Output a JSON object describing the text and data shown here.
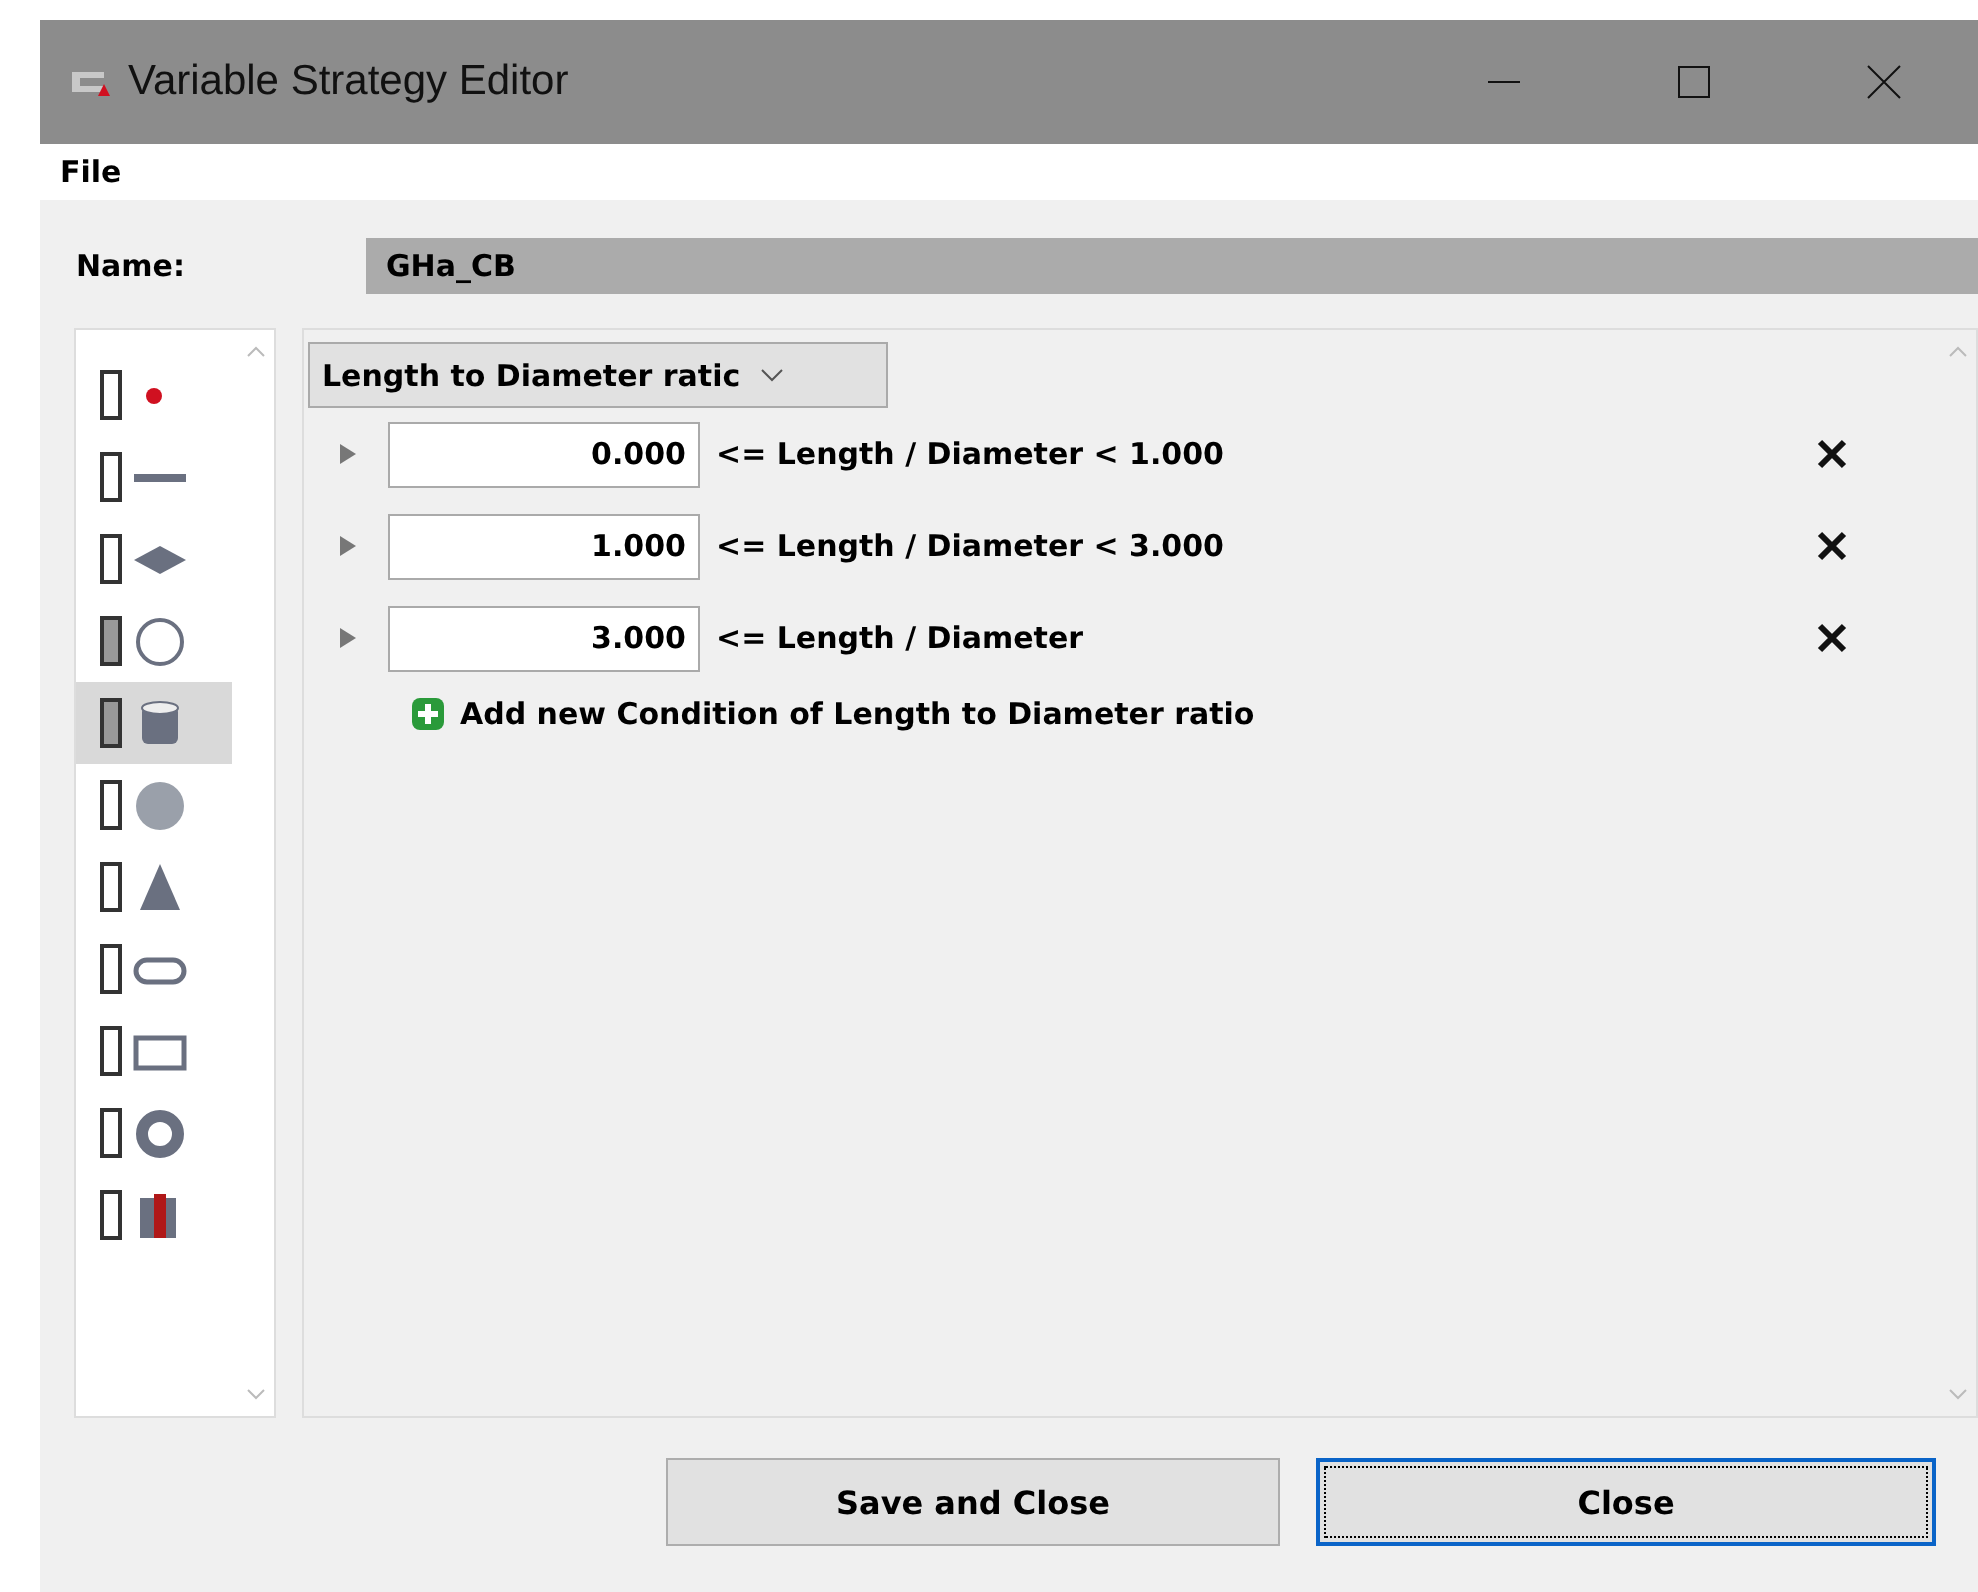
{
  "window": {
    "title": "Variable Strategy Editor"
  },
  "menu": [
    "File"
  ],
  "name_field": {
    "label": "Name:",
    "value": "GHa_CB"
  },
  "shapes": [
    {
      "kind": "point",
      "checked": false,
      "selected": false
    },
    {
      "kind": "line",
      "checked": false,
      "selected": false
    },
    {
      "kind": "plate",
      "checked": false,
      "selected": false
    },
    {
      "kind": "ring",
      "checked": true,
      "selected": false
    },
    {
      "kind": "cylinder",
      "checked": true,
      "selected": true
    },
    {
      "kind": "sphere",
      "checked": false,
      "selected": false
    },
    {
      "kind": "cone",
      "checked": false,
      "selected": false
    },
    {
      "kind": "capsule",
      "checked": false,
      "selected": false
    },
    {
      "kind": "box",
      "checked": false,
      "selected": false
    },
    {
      "kind": "torus",
      "checked": false,
      "selected": false
    },
    {
      "kind": "cut",
      "checked": false,
      "selected": false
    }
  ],
  "variable_dropdown": "Length to Diameter ratic",
  "conditions": [
    {
      "value": "0.000",
      "text": "<= Length / Diameter < 1.000"
    },
    {
      "value": "1.000",
      "text": "<= Length / Diameter < 3.000"
    },
    {
      "value": "3.000",
      "text": "<= Length / Diameter"
    }
  ],
  "add_condition": "Add new Condition of Length to Diameter ratio",
  "buttons": [
    {
      "label": "Save and Close",
      "focused": false
    },
    {
      "label": "Close",
      "focused": true
    }
  ]
}
